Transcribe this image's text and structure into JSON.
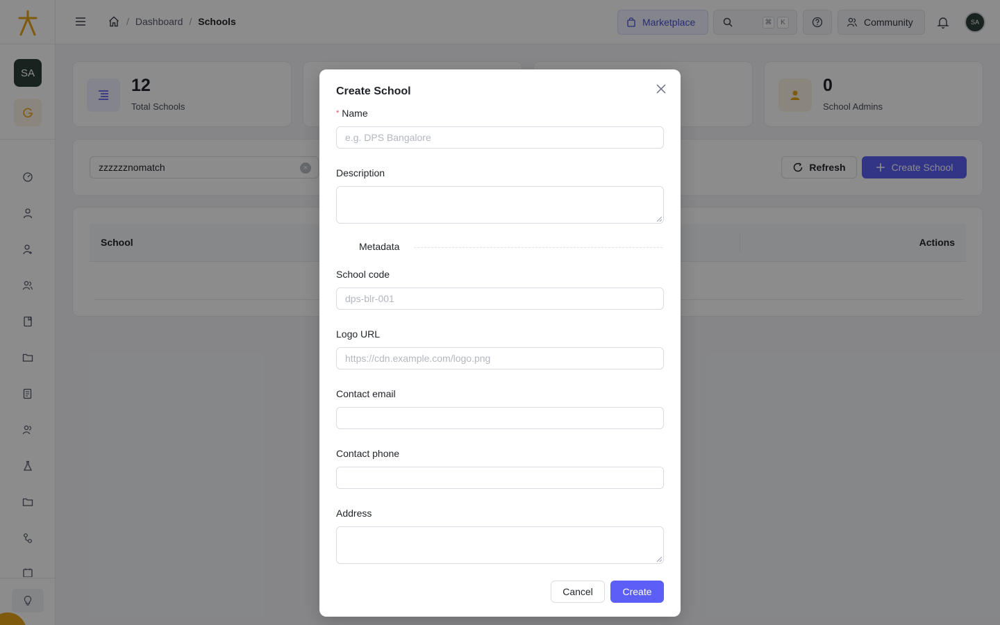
{
  "app": {
    "logo": "app-logo",
    "user_initials": "SA"
  },
  "breadcrumb": {
    "home_icon": "home-icon",
    "items": [
      "Dashboard",
      "Schools"
    ],
    "separator": "/"
  },
  "topbar": {
    "marketplace_label": "Marketplace",
    "search_shortcut": [
      "⌘",
      "K"
    ],
    "community_label": "Community",
    "avatar_initials": "SA"
  },
  "stats": [
    {
      "value": "12",
      "label": "Total Schools",
      "icon": "list-icon",
      "color": "#5b5ff5"
    },
    {
      "value": "0",
      "label": "School Admins",
      "icon": "user-icon",
      "color": "#e8a317"
    }
  ],
  "filters": {
    "search_value": "zzzzzznomatch",
    "refresh_label": "Refresh",
    "create_label": "Create School"
  },
  "table": {
    "columns": [
      "School",
      "Actions"
    ]
  },
  "modal": {
    "title": "Create School",
    "fields": {
      "name": {
        "label": "Name",
        "placeholder": "e.g. DPS Bangalore",
        "required_mark": "*"
      },
      "description": {
        "label": "Description"
      },
      "metadata_heading": "Metadata",
      "school_code": {
        "label": "School code",
        "placeholder": "dps-blr-001"
      },
      "logo_url": {
        "label": "Logo URL",
        "placeholder": "https://cdn.example.com/logo.png"
      },
      "contact_email": {
        "label": "Contact email",
        "placeholder": ""
      },
      "contact_phone": {
        "label": "Contact phone",
        "placeholder": ""
      },
      "address": {
        "label": "Address"
      }
    },
    "cancel_label": "Cancel",
    "submit_label": "Create"
  },
  "colors": {
    "accent": "#5b5ff5",
    "brand": "#e8a317"
  }
}
